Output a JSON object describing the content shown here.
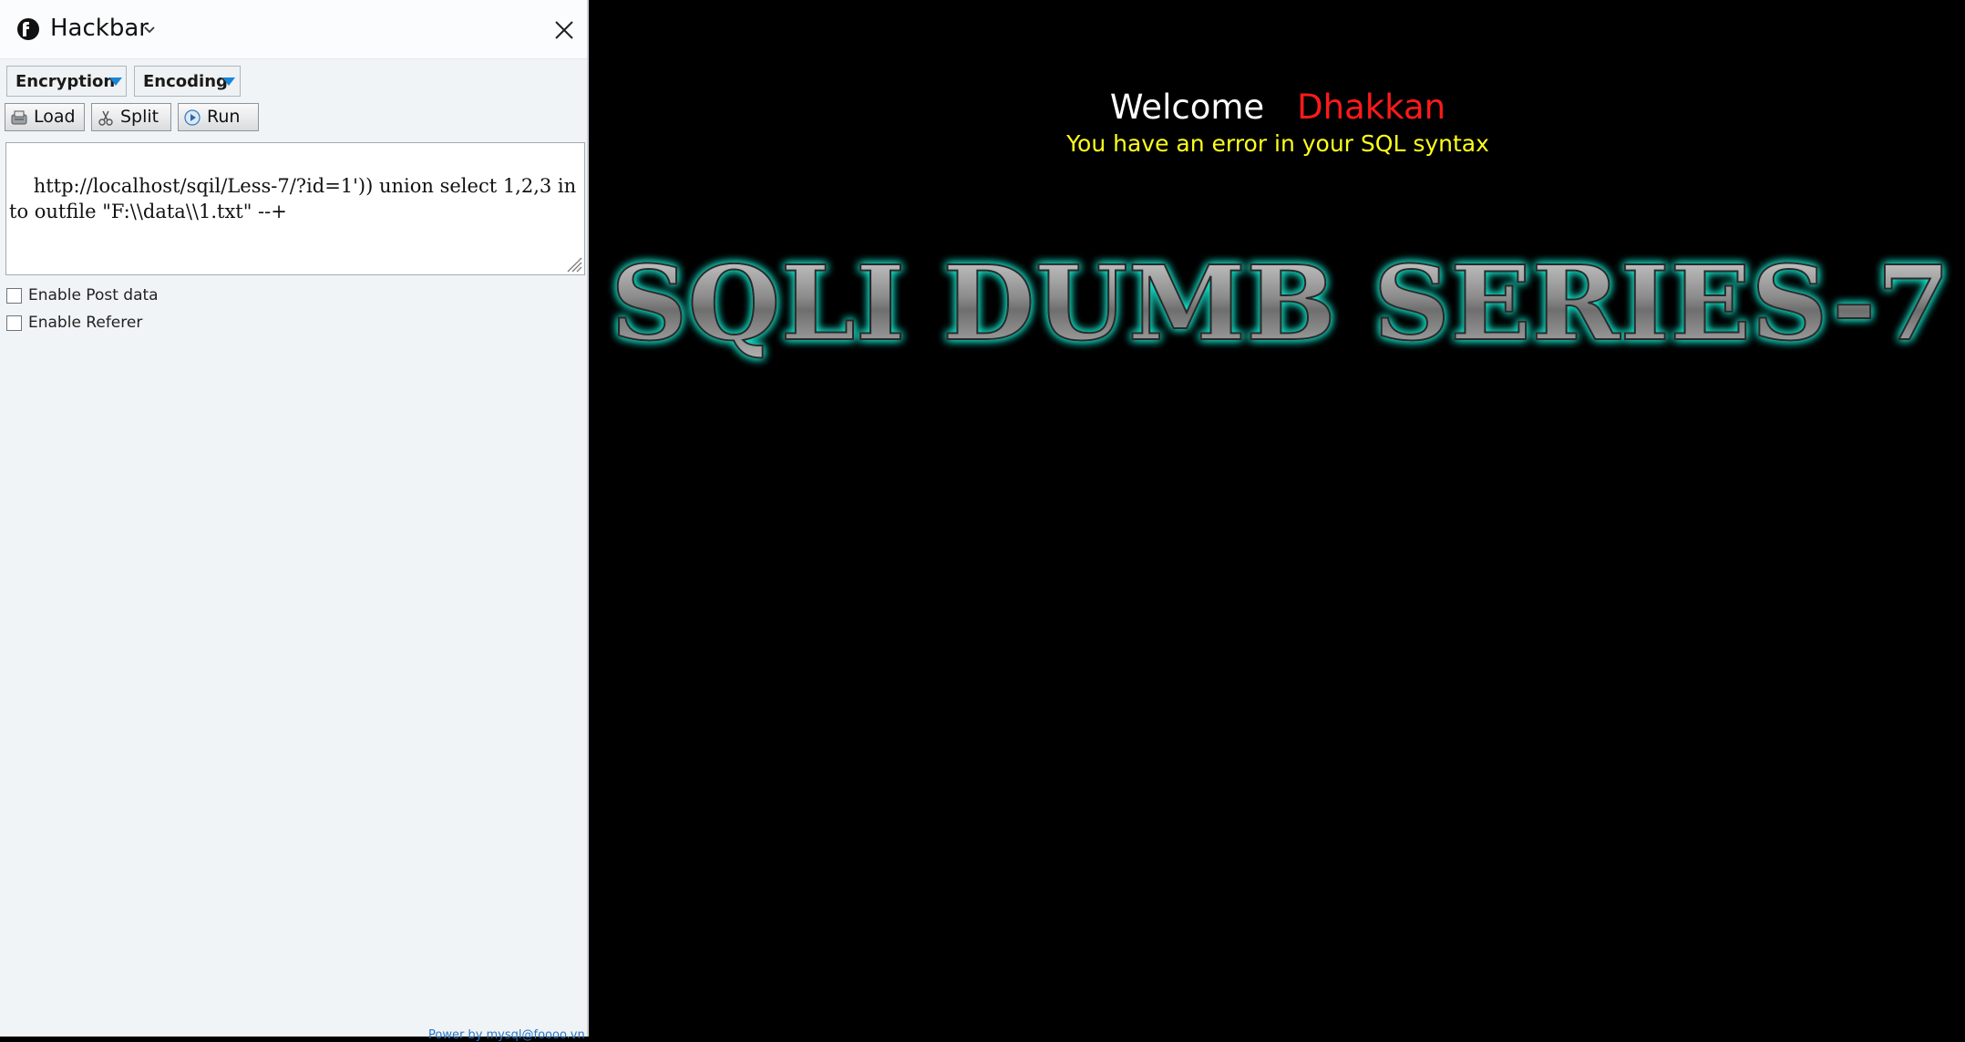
{
  "sidebar": {
    "title": "Hackbar",
    "encryption_label": "Encryption",
    "encoding_label": "Encoding",
    "load_label": "Load",
    "split_label": "Split",
    "run_label": "Run",
    "url_value": "http://localhost/sqil/Less-7/?id=1')) union select 1,2,3 into outfile \"F:\\\\data\\\\1.txt\" --+",
    "enable_post_label": "Enable Post data",
    "enable_referer_label": "Enable Referer",
    "footer_text": "Power by mysql@foooo.vn"
  },
  "page": {
    "welcome": "Welcome",
    "user_name": "Dhakkan",
    "error_message": "You have an error in your SQL syntax",
    "banner_text": "SQLI DUMB SERIES-7"
  },
  "colors": {
    "page_background": "#000000",
    "user_name": "#ff1a1a",
    "error_message": "#ffff1a",
    "banner_glow": "#19e0c8",
    "sidebar_background": "#f0f4f6"
  },
  "icons": {
    "logo": "hackbar-logo-icon",
    "chevron": "chevron-down-icon",
    "close": "close-icon",
    "dropdown": "triangle-down-icon",
    "load": "load-icon",
    "split": "split-icon",
    "run": "run-icon"
  }
}
